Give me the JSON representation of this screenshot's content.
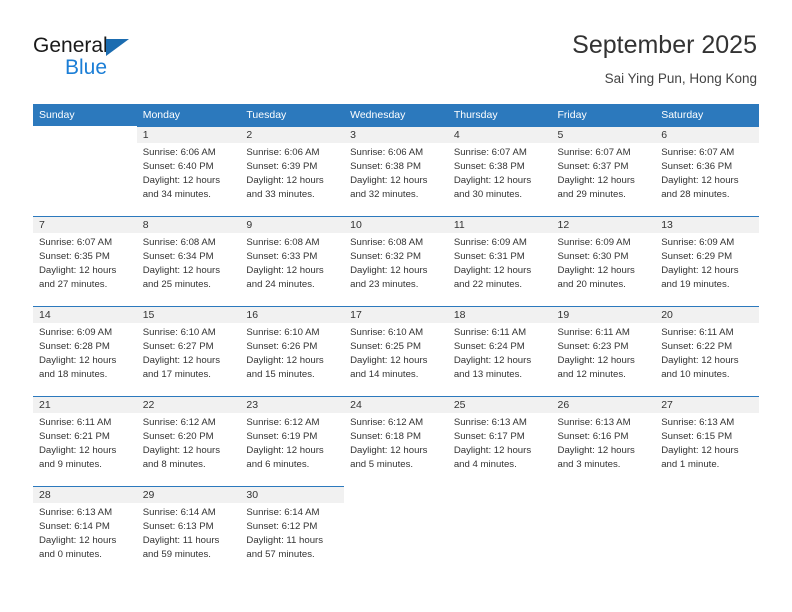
{
  "brand": {
    "name_part1": "General",
    "name_part2": "Blue",
    "triangle_icon": "triangle-icon",
    "accent_blue": "#1b7ed6",
    "logo_blue": "#1b6cb0"
  },
  "header": {
    "title": "September 2025",
    "subtitle": "Sai Ying Pun, Hong Kong"
  },
  "theme": {
    "header_row_bg": "#2c79bd",
    "header_row_text": "#ffffff",
    "daynum_bg": "#f1f1f1",
    "row_rule": "#2c79bd",
    "body_text": "#333333"
  },
  "calendar": {
    "weekday_headers": [
      "Sunday",
      "Monday",
      "Tuesday",
      "Wednesday",
      "Thursday",
      "Friday",
      "Saturday"
    ],
    "weeks": [
      [
        {
          "day": "",
          "lines": []
        },
        {
          "day": "1",
          "lines": [
            "Sunrise: 6:06 AM",
            "Sunset: 6:40 PM",
            "Daylight: 12 hours",
            "and 34 minutes."
          ]
        },
        {
          "day": "2",
          "lines": [
            "Sunrise: 6:06 AM",
            "Sunset: 6:39 PM",
            "Daylight: 12 hours",
            "and 33 minutes."
          ]
        },
        {
          "day": "3",
          "lines": [
            "Sunrise: 6:06 AM",
            "Sunset: 6:38 PM",
            "Daylight: 12 hours",
            "and 32 minutes."
          ]
        },
        {
          "day": "4",
          "lines": [
            "Sunrise: 6:07 AM",
            "Sunset: 6:38 PM",
            "Daylight: 12 hours",
            "and 30 minutes."
          ]
        },
        {
          "day": "5",
          "lines": [
            "Sunrise: 6:07 AM",
            "Sunset: 6:37 PM",
            "Daylight: 12 hours",
            "and 29 minutes."
          ]
        },
        {
          "day": "6",
          "lines": [
            "Sunrise: 6:07 AM",
            "Sunset: 6:36 PM",
            "Daylight: 12 hours",
            "and 28 minutes."
          ]
        }
      ],
      [
        {
          "day": "7",
          "lines": [
            "Sunrise: 6:07 AM",
            "Sunset: 6:35 PM",
            "Daylight: 12 hours",
            "and 27 minutes."
          ]
        },
        {
          "day": "8",
          "lines": [
            "Sunrise: 6:08 AM",
            "Sunset: 6:34 PM",
            "Daylight: 12 hours",
            "and 25 minutes."
          ]
        },
        {
          "day": "9",
          "lines": [
            "Sunrise: 6:08 AM",
            "Sunset: 6:33 PM",
            "Daylight: 12 hours",
            "and 24 minutes."
          ]
        },
        {
          "day": "10",
          "lines": [
            "Sunrise: 6:08 AM",
            "Sunset: 6:32 PM",
            "Daylight: 12 hours",
            "and 23 minutes."
          ]
        },
        {
          "day": "11",
          "lines": [
            "Sunrise: 6:09 AM",
            "Sunset: 6:31 PM",
            "Daylight: 12 hours",
            "and 22 minutes."
          ]
        },
        {
          "day": "12",
          "lines": [
            "Sunrise: 6:09 AM",
            "Sunset: 6:30 PM",
            "Daylight: 12 hours",
            "and 20 minutes."
          ]
        },
        {
          "day": "13",
          "lines": [
            "Sunrise: 6:09 AM",
            "Sunset: 6:29 PM",
            "Daylight: 12 hours",
            "and 19 minutes."
          ]
        }
      ],
      [
        {
          "day": "14",
          "lines": [
            "Sunrise: 6:09 AM",
            "Sunset: 6:28 PM",
            "Daylight: 12 hours",
            "and 18 minutes."
          ]
        },
        {
          "day": "15",
          "lines": [
            "Sunrise: 6:10 AM",
            "Sunset: 6:27 PM",
            "Daylight: 12 hours",
            "and 17 minutes."
          ]
        },
        {
          "day": "16",
          "lines": [
            "Sunrise: 6:10 AM",
            "Sunset: 6:26 PM",
            "Daylight: 12 hours",
            "and 15 minutes."
          ]
        },
        {
          "day": "17",
          "lines": [
            "Sunrise: 6:10 AM",
            "Sunset: 6:25 PM",
            "Daylight: 12 hours",
            "and 14 minutes."
          ]
        },
        {
          "day": "18",
          "lines": [
            "Sunrise: 6:11 AM",
            "Sunset: 6:24 PM",
            "Daylight: 12 hours",
            "and 13 minutes."
          ]
        },
        {
          "day": "19",
          "lines": [
            "Sunrise: 6:11 AM",
            "Sunset: 6:23 PM",
            "Daylight: 12 hours",
            "and 12 minutes."
          ]
        },
        {
          "day": "20",
          "lines": [
            "Sunrise: 6:11 AM",
            "Sunset: 6:22 PM",
            "Daylight: 12 hours",
            "and 10 minutes."
          ]
        }
      ],
      [
        {
          "day": "21",
          "lines": [
            "Sunrise: 6:11 AM",
            "Sunset: 6:21 PM",
            "Daylight: 12 hours",
            "and 9 minutes."
          ]
        },
        {
          "day": "22",
          "lines": [
            "Sunrise: 6:12 AM",
            "Sunset: 6:20 PM",
            "Daylight: 12 hours",
            "and 8 minutes."
          ]
        },
        {
          "day": "23",
          "lines": [
            "Sunrise: 6:12 AM",
            "Sunset: 6:19 PM",
            "Daylight: 12 hours",
            "and 6 minutes."
          ]
        },
        {
          "day": "24",
          "lines": [
            "Sunrise: 6:12 AM",
            "Sunset: 6:18 PM",
            "Daylight: 12 hours",
            "and 5 minutes."
          ]
        },
        {
          "day": "25",
          "lines": [
            "Sunrise: 6:13 AM",
            "Sunset: 6:17 PM",
            "Daylight: 12 hours",
            "and 4 minutes."
          ]
        },
        {
          "day": "26",
          "lines": [
            "Sunrise: 6:13 AM",
            "Sunset: 6:16 PM",
            "Daylight: 12 hours",
            "and 3 minutes."
          ]
        },
        {
          "day": "27",
          "lines": [
            "Sunrise: 6:13 AM",
            "Sunset: 6:15 PM",
            "Daylight: 12 hours",
            "and 1 minute."
          ]
        }
      ],
      [
        {
          "day": "28",
          "lines": [
            "Sunrise: 6:13 AM",
            "Sunset: 6:14 PM",
            "Daylight: 12 hours",
            "and 0 minutes."
          ]
        },
        {
          "day": "29",
          "lines": [
            "Sunrise: 6:14 AM",
            "Sunset: 6:13 PM",
            "Daylight: 11 hours",
            "and 59 minutes."
          ]
        },
        {
          "day": "30",
          "lines": [
            "Sunrise: 6:14 AM",
            "Sunset: 6:12 PM",
            "Daylight: 11 hours",
            "and 57 minutes."
          ]
        },
        {
          "day": "",
          "lines": []
        },
        {
          "day": "",
          "lines": []
        },
        {
          "day": "",
          "lines": []
        },
        {
          "day": "",
          "lines": []
        }
      ]
    ]
  }
}
